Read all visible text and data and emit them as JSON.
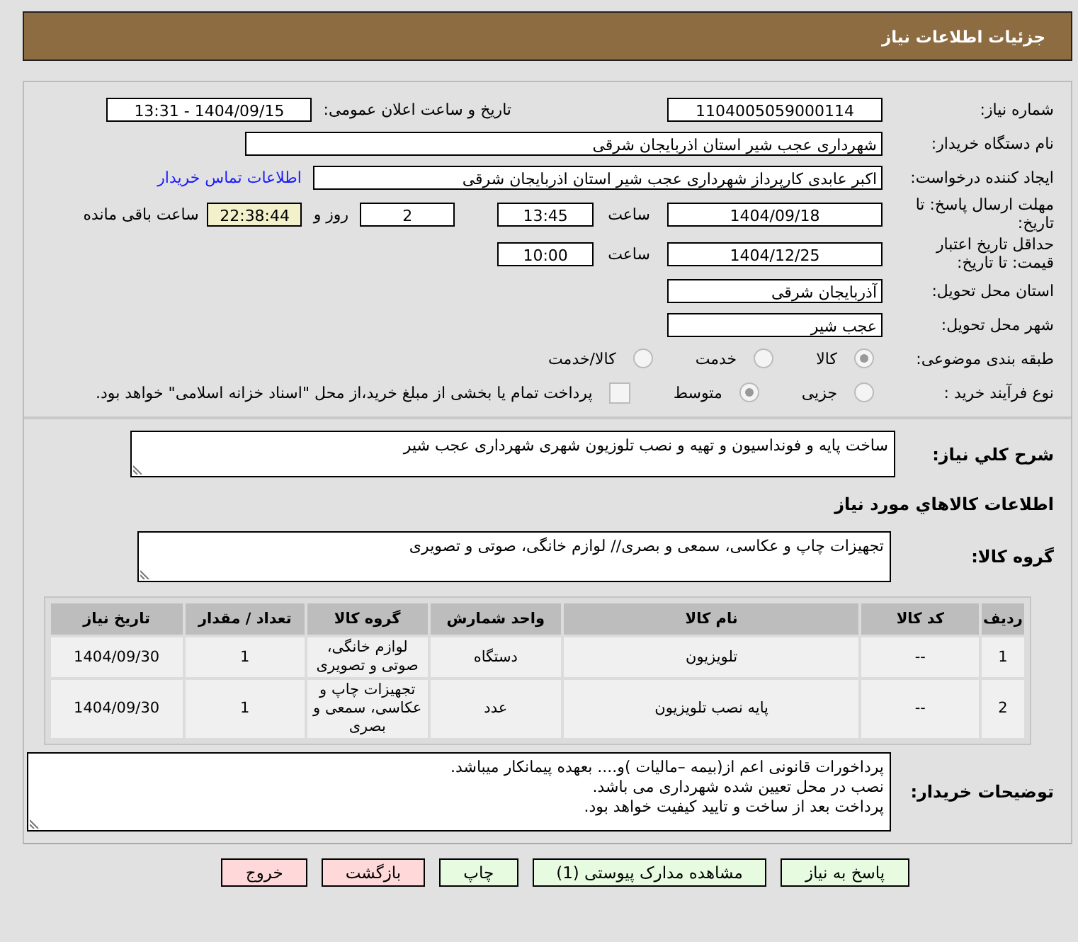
{
  "header": {
    "title": "جزئیات اطلاعات نیاز"
  },
  "need_number": {
    "label": "شماره نیاز:",
    "value": "1104005059000114"
  },
  "announce": {
    "label": "تاریخ و ساعت اعلان عمومی:",
    "value": "1404/09/15 - 13:31"
  },
  "buyer": {
    "label": "نام دستگاه خریدار:",
    "value": "شهرداری عجب شیر استان اذربایجان شرقی"
  },
  "creator": {
    "label": "ایجاد کننده درخواست:",
    "value": "اکبر عابدی کارپرداز شهرداری عجب شیر استان اذربایجان شرقی",
    "link": "اطلاعات تماس خریدار"
  },
  "deadline": {
    "label": "مهلت ارسال پاسخ: تا تاریخ:",
    "date": "1404/09/18",
    "time_label": "ساعت",
    "time": "13:45",
    "days": "2",
    "days_label": "روز و",
    "remaining": "22:38:44",
    "remaining_label": "ساعت باقی مانده"
  },
  "validity": {
    "label": "حداقل تاریخ اعتبار قیمت: تا تاریخ:",
    "date": "1404/12/25",
    "time_label": "ساعت",
    "time": "10:00"
  },
  "province": {
    "label": "استان محل تحویل:",
    "value": "آذربایجان شرقی"
  },
  "city": {
    "label": "شهر محل تحویل:",
    "value": "عجب شیر"
  },
  "category": {
    "label": "طبقه بندی موضوعی:",
    "options": [
      {
        "label": "کالا",
        "selected": true
      },
      {
        "label": "خدمت",
        "selected": false
      },
      {
        "label": "کالا/خدمت",
        "selected": false
      }
    ]
  },
  "process": {
    "label": "نوع فرآیند خرید :",
    "options": [
      {
        "label": "جزیی",
        "selected": false
      },
      {
        "label": "متوسط",
        "selected": true
      }
    ],
    "treasury": {
      "label": "پرداخت تمام یا بخشی از مبلغ خرید،از محل \"اسناد خزانه اسلامی\" خواهد بود.",
      "checked": false
    }
  },
  "summary": {
    "label": "شرح کلي نياز:",
    "value": "ساخت پایه و فونداسیون و تهیه و نصب تلوزیون شهری شهرداری عجب شیر"
  },
  "goods_title": "اطلاعات کالاهاي مورد نياز",
  "goods_group": {
    "label": "گروه کالا:",
    "value": "تجهیزات چاپ و عکاسی، سمعی و بصری// لوازم خانگی، صوتی و تصویری"
  },
  "table": {
    "columns": [
      "ردیف",
      "کد کالا",
      "نام کالا",
      "واحد شمارش",
      "گروه کالا",
      "تعداد / مقدار",
      "تاریخ نیاز"
    ],
    "rows": [
      [
        "1",
        "--",
        "تلویزیون",
        "دستگاه",
        "لوازم خانگی، صوتی و تصویری",
        "1",
        "1404/09/30"
      ],
      [
        "2",
        "--",
        "پایه نصب تلویزیون",
        "عدد",
        "تجهیزات چاپ و عکاسی، سمعی و بصری",
        "1",
        "1404/09/30"
      ]
    ]
  },
  "notes": {
    "label": "توضیحات خریدار:",
    "lines": [
      " پرداخورات قانونی اعم از(بیمه –مالیات )و.... بعهده پیمانکار میباشد.",
      "نصب  در محل تعیین شده شهرداری می باشد.",
      "پرداخت بعد از  ساخت و تایید کیفیت خواهد بود."
    ]
  },
  "buttons": [
    {
      "label": "پاسخ به نیاز",
      "kind": "action"
    },
    {
      "label": "مشاهده مدارک پیوستی (1)",
      "kind": "action"
    },
    {
      "label": "چاپ",
      "kind": "action"
    },
    {
      "label": "بازگشت",
      "kind": "exit"
    },
    {
      "label": "خروج",
      "kind": "exit"
    }
  ]
}
